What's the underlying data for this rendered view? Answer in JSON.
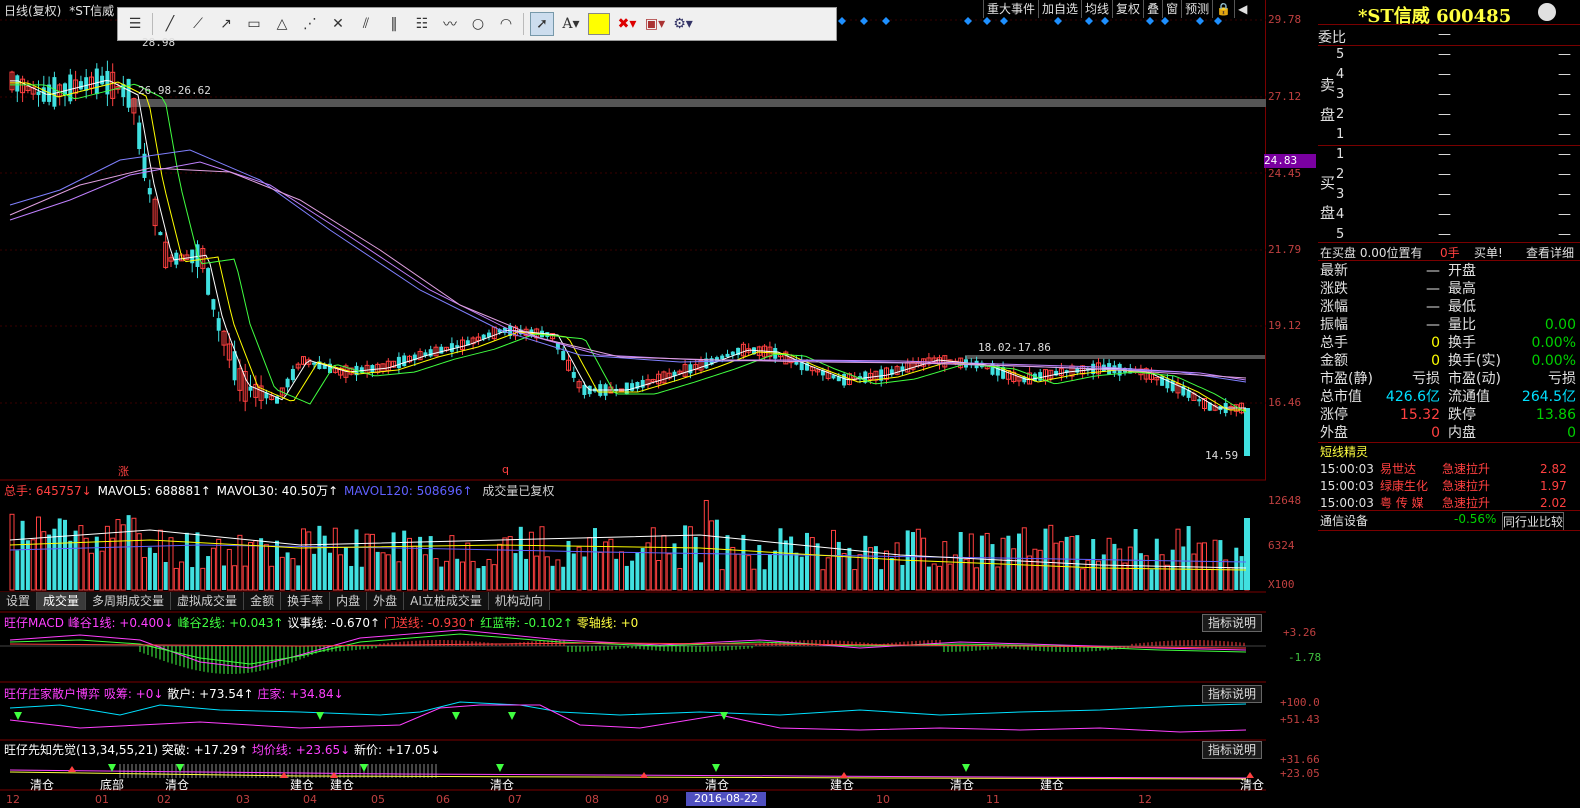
{
  "chart_header": {
    "title": "日线(复权)",
    "stock": "*ST信威"
  },
  "top_menu": [
    "重大事件",
    "加自选",
    "均线",
    "复权",
    "叠",
    "窗",
    "预测"
  ],
  "toolbar": {
    "tools": [
      "settings",
      "segment-line",
      "ray-line",
      "diagonal-line",
      "rectangle",
      "triangle",
      "fan-lines",
      "gann",
      "parallel-lines",
      "horizontal-lines",
      "fibonacci",
      "wave",
      "circle",
      "arc",
      "pointer",
      "text",
      "color",
      "delete",
      "save",
      "gear"
    ]
  },
  "price_axis": [
    "29.78",
    "27.12",
    "24.45",
    "21.79",
    "19.12",
    "16.46"
  ],
  "current_price_label": "24.83",
  "annotations": {
    "high_band": "26.98-26.62",
    "high_top": "28.98",
    "mid_band": "18.02-17.86",
    "low": "14.59",
    "marker_zhang": "涨",
    "marker_q": "q"
  },
  "volume": {
    "header": [
      {
        "text": "总手: 645757↓",
        "color": "#ff4040"
      },
      {
        "text": "MAVOL5: 688881↑",
        "color": "#ffffff"
      },
      {
        "text": "MAVOL30: 40.50万↑",
        "color": "#ffffff"
      },
      {
        "text": "MAVOL120: 508696↑",
        "color": "#6060ff"
      },
      {
        "text": "成交量已复权",
        "color": "#d0d0d0"
      }
    ],
    "axis": [
      "12648",
      "6324",
      "X100"
    ]
  },
  "tabs": [
    "设置",
    "成交量",
    "多周期成交量",
    "虚拟成交量",
    "金额",
    "换手率",
    "内盘",
    "外盘",
    "AI立桩成交量",
    "机构动向"
  ],
  "active_tab": "成交量",
  "macd": {
    "header": [
      {
        "text": "旺仔MACD",
        "color": "#ff40ff"
      },
      {
        "text": "峰谷1线: +0.400↓",
        "color": "#ff40ff"
      },
      {
        "text": "峰谷2线: +0.043↑",
        "color": "#40ff40"
      },
      {
        "text": "议事线: -0.670↑",
        "color": "#ffffff"
      },
      {
        "text": "门送线: -0.930↑",
        "color": "#ff4040"
      },
      {
        "text": "红蓝带: -0.102↑",
        "color": "#40ff40"
      },
      {
        "text": "零轴线: +0",
        "color": "#ffff40"
      }
    ],
    "axis": [
      "+3.26",
      "-1.78"
    ],
    "button": "指标说明"
  },
  "game": {
    "header": [
      {
        "text": "旺仔庄家散户博弈 吸筹: +0↓",
        "color": "#ff40ff"
      },
      {
        "text": "散户: +73.54↑",
        "color": "#ffffff"
      },
      {
        "text": "庄家: +34.84↓",
        "color": "#ff40ff"
      }
    ],
    "axis": [
      "+100.0",
      "+51.43"
    ],
    "button": "指标说明"
  },
  "foresee": {
    "header": [
      {
        "text": "旺仔先知先觉(13,34,55,21)",
        "color": "#ffffff"
      },
      {
        "text": "突破: +17.29↑",
        "color": "#ffffff"
      },
      {
        "text": "均价线: +23.65↓",
        "color": "#ff40ff"
      },
      {
        "text": "新价: +17.05↓",
        "color": "#ffffff"
      }
    ],
    "axis": [
      "+31.66",
      "+23.05"
    ],
    "button": "指标说明",
    "labels": [
      "清仓",
      "底部",
      "清仓",
      "建仓",
      "建仓",
      "清仓",
      "清仓",
      "建仓",
      "清仓",
      "建仓",
      "清仓"
    ]
  },
  "date_axis": [
    "12",
    "01",
    "02",
    "03",
    "04",
    "05",
    "06",
    "07",
    "08",
    "09",
    "10",
    "11",
    "12"
  ],
  "date_cursor": "2016-08-22",
  "quote": {
    "name": "*ST信威 600485",
    "weibi_label": "委比",
    "weibi_val": "—",
    "sell_label": "卖盘",
    "buy_label": "买盘",
    "sell": [
      {
        "n": "5",
        "p": "—",
        "v": "—"
      },
      {
        "n": "4",
        "p": "—",
        "v": "—"
      },
      {
        "n": "3",
        "p": "—",
        "v": "—"
      },
      {
        "n": "2",
        "p": "—",
        "v": "—"
      },
      {
        "n": "1",
        "p": "—",
        "v": "—"
      }
    ],
    "buy": [
      {
        "n": "1",
        "p": "—",
        "v": "—"
      },
      {
        "n": "2",
        "p": "—",
        "v": "—"
      },
      {
        "n": "3",
        "p": "—",
        "v": "—"
      },
      {
        "n": "4",
        "p": "—",
        "v": "—"
      },
      {
        "n": "5",
        "p": "—",
        "v": "—"
      }
    ],
    "position_line": {
      "text": "在买盘 0.00位置有",
      "vol": "0手",
      "buy_btn": "买单!",
      "detail": "查看详细"
    },
    "stats": [
      {
        "l1": "最新",
        "v1": "—",
        "c1": "#e0e0e0",
        "l2": "开盘",
        "v2": "",
        "c2": "#e0e0e0"
      },
      {
        "l1": "涨跌",
        "v1": "—",
        "c1": "#e0e0e0",
        "l2": "最高",
        "v2": "",
        "c2": "#e0e0e0"
      },
      {
        "l1": "涨幅",
        "v1": "—",
        "c1": "#e0e0e0",
        "l2": "最低",
        "v2": "",
        "c2": "#e0e0e0"
      },
      {
        "l1": "振幅",
        "v1": "—",
        "c1": "#e0e0e0",
        "l2": "量比",
        "v2": "0.00",
        "c2": "#00d000"
      },
      {
        "l1": "总手",
        "v1": "0",
        "c1": "#ffff00",
        "l2": "换手",
        "v2": "0.00%",
        "c2": "#00d000"
      },
      {
        "l1": "金额",
        "v1": "0",
        "c1": "#ffff00",
        "l2": "换手(实)",
        "v2": "0.00%",
        "c2": "#00d000"
      },
      {
        "l1": "市盈(静)",
        "v1": "亏损",
        "c1": "#e0e0e0",
        "l2": "市盈(动)",
        "v2": "亏损",
        "c2": "#e0e0e0"
      },
      {
        "l1": "总市值",
        "v1": "426.6亿",
        "c1": "#00e0ff",
        "l2": "流通值",
        "v2": "264.5亿",
        "c2": "#00e0ff"
      },
      {
        "l1": "涨停",
        "v1": "15.32",
        "c1": "#ff4040",
        "l2": "跌停",
        "v2": "13.86",
        "c2": "#00d000"
      },
      {
        "l1": "外盘",
        "v1": "0",
        "c1": "#ff4040",
        "l2": "内盘",
        "v2": "0",
        "c2": "#00d000"
      }
    ],
    "sprite_title": "短线精灵",
    "sprite": [
      {
        "t": "15:00:03",
        "name": "易世达",
        "evt": "急速拉升",
        "val": "2.82"
      },
      {
        "t": "15:00:03",
        "name": "绿康生化",
        "evt": "急速拉升",
        "val": "1.97"
      },
      {
        "t": "15:00:03",
        "name": "粤 传 媒",
        "evt": "急速拉升",
        "val": "2.02"
      }
    ],
    "industry": {
      "name": "通信设备",
      "pct": "-0.56%",
      "btn": "同行业比较"
    }
  },
  "colors": {
    "up": "#ff4040",
    "down": "#40e0e0",
    "ma5": "#ffffff",
    "ma10": "#ffff00",
    "ma20": "#ff40ff",
    "ma30": "#40ff40",
    "ma60": "#8080ff",
    "ma120": "#c080ff",
    "panel_border": "#7a0000"
  }
}
